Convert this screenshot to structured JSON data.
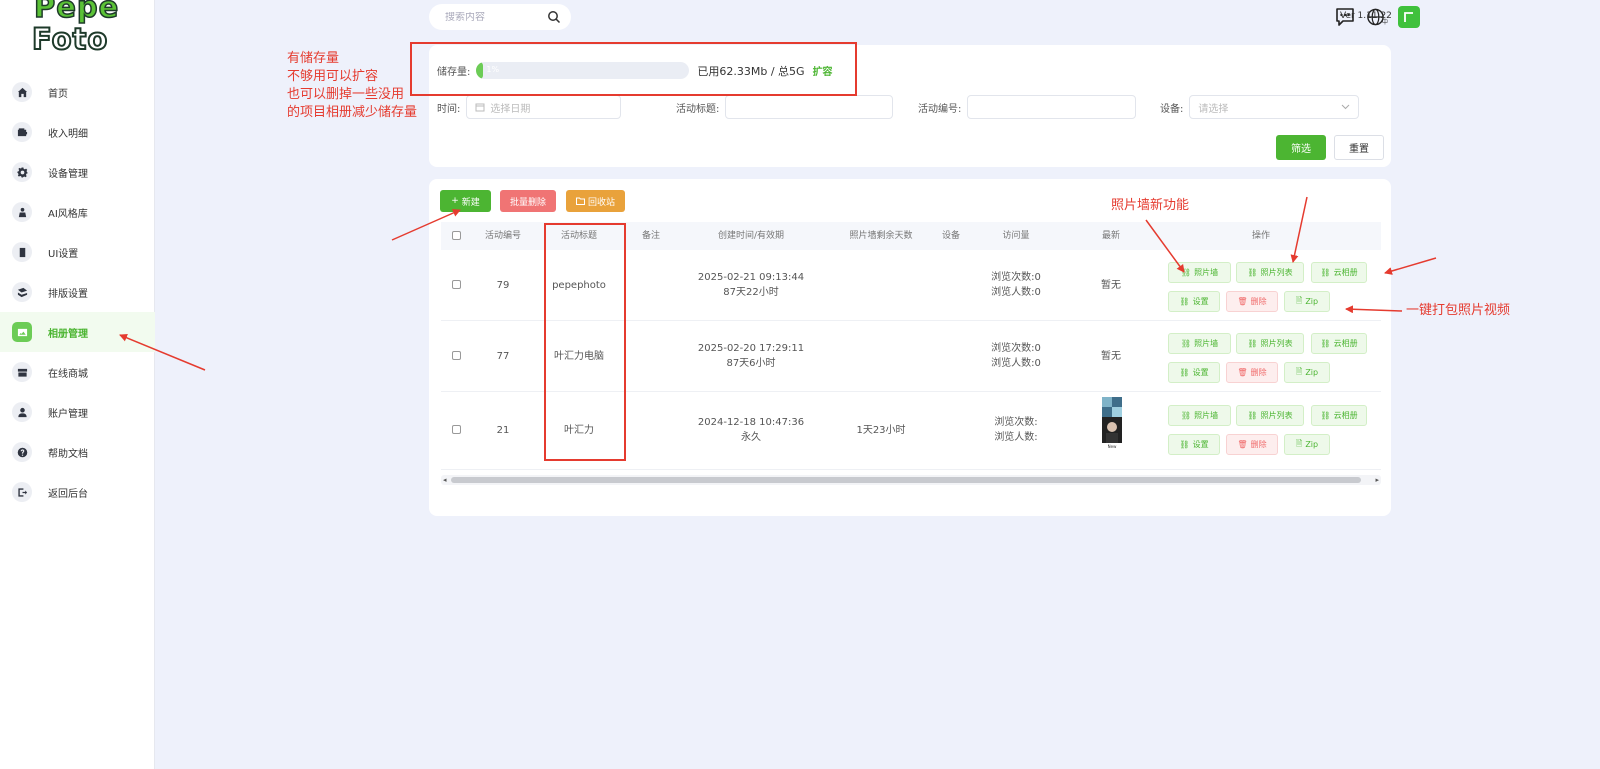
{
  "logo": {
    "line1": "Pepe",
    "line2": "Foto"
  },
  "sidebar": {
    "items": [
      {
        "label": "首页",
        "icon": "home-icon"
      },
      {
        "label": "收入明细",
        "icon": "wallet-icon"
      },
      {
        "label": "设备管理",
        "icon": "gear-icon"
      },
      {
        "label": "AI风格库",
        "icon": "ai-style-icon"
      },
      {
        "label": "UI设置",
        "icon": "phone-icon"
      },
      {
        "label": "排版设置",
        "icon": "layout-icon"
      },
      {
        "label": "相册管理",
        "icon": "album-icon",
        "active": true
      },
      {
        "label": "在线商城",
        "icon": "store-icon"
      },
      {
        "label": "账户管理",
        "icon": "user-icon"
      },
      {
        "label": "帮助文档",
        "icon": "help-icon"
      },
      {
        "label": "返回后台",
        "icon": "exit-icon"
      }
    ]
  },
  "topbar": {
    "search_placeholder": "搜索内容",
    "lang_sub": "中",
    "version": "Ver 1.11.22"
  },
  "storage": {
    "label": "储存量:",
    "percent": 1,
    "percent_label": "1%",
    "used_text": "已用62.33Mb / 总5G",
    "expand": "扩容"
  },
  "filters": {
    "time_label": "时间:",
    "time_placeholder": "选择日期",
    "title_label": "活动标题:",
    "id_label": "活动编号:",
    "device_label": "设备:",
    "device_placeholder": "请选择",
    "filter_button": "筛选",
    "reset_button": "重置"
  },
  "toolbar": {
    "new": "新建",
    "batch_delete": "批量删除",
    "recycle": "回收站"
  },
  "table": {
    "headers": [
      "活动编号",
      "活动标题",
      "备注",
      "创建时间/有效期",
      "照片墙剩余天数",
      "设备",
      "访问量",
      "最新",
      "操作"
    ],
    "rows": [
      {
        "id": "79",
        "title": "pepephoto",
        "note": "",
        "created": "2025-02-21 09:13:44",
        "validity": "87天22小时",
        "wall_days": "",
        "device": "",
        "views": "浏览次数:0",
        "visitors": "浏览人数:0",
        "latest": "暂无"
      },
      {
        "id": "77",
        "title": "叶汇力电脑",
        "note": "",
        "created": "2025-02-20 17:29:11",
        "validity": "87天6小时",
        "wall_days": "",
        "device": "",
        "views": "浏览次数:0",
        "visitors": "浏览人数:0",
        "latest": "暂无"
      },
      {
        "id": "21",
        "title": "叶汇力",
        "note": "",
        "created": "2024-12-18 10:47:36",
        "validity": "永久",
        "wall_days": "1天23小时",
        "device": "",
        "views": "浏览次数:",
        "visitors": "浏览人数:",
        "latest": ""
      }
    ],
    "ops": {
      "wall": "照片墙",
      "list": "照片列表",
      "cloud": "云相册",
      "settings": "设置",
      "delete": "删除",
      "zip": "Zip"
    }
  },
  "annotations": {
    "storage_note": [
      "有储存量",
      "不够用可以扩容",
      "也可以删掉一些没用",
      "的项目相册减少储存量"
    ],
    "wall_note": "照片墙新功能",
    "zip_note": "一键打包照片视频"
  },
  "colors": {
    "accent": "#4cb532",
    "danger": "#f06a6a",
    "warning": "#e9a23b",
    "annotation": "#e53b2f"
  }
}
